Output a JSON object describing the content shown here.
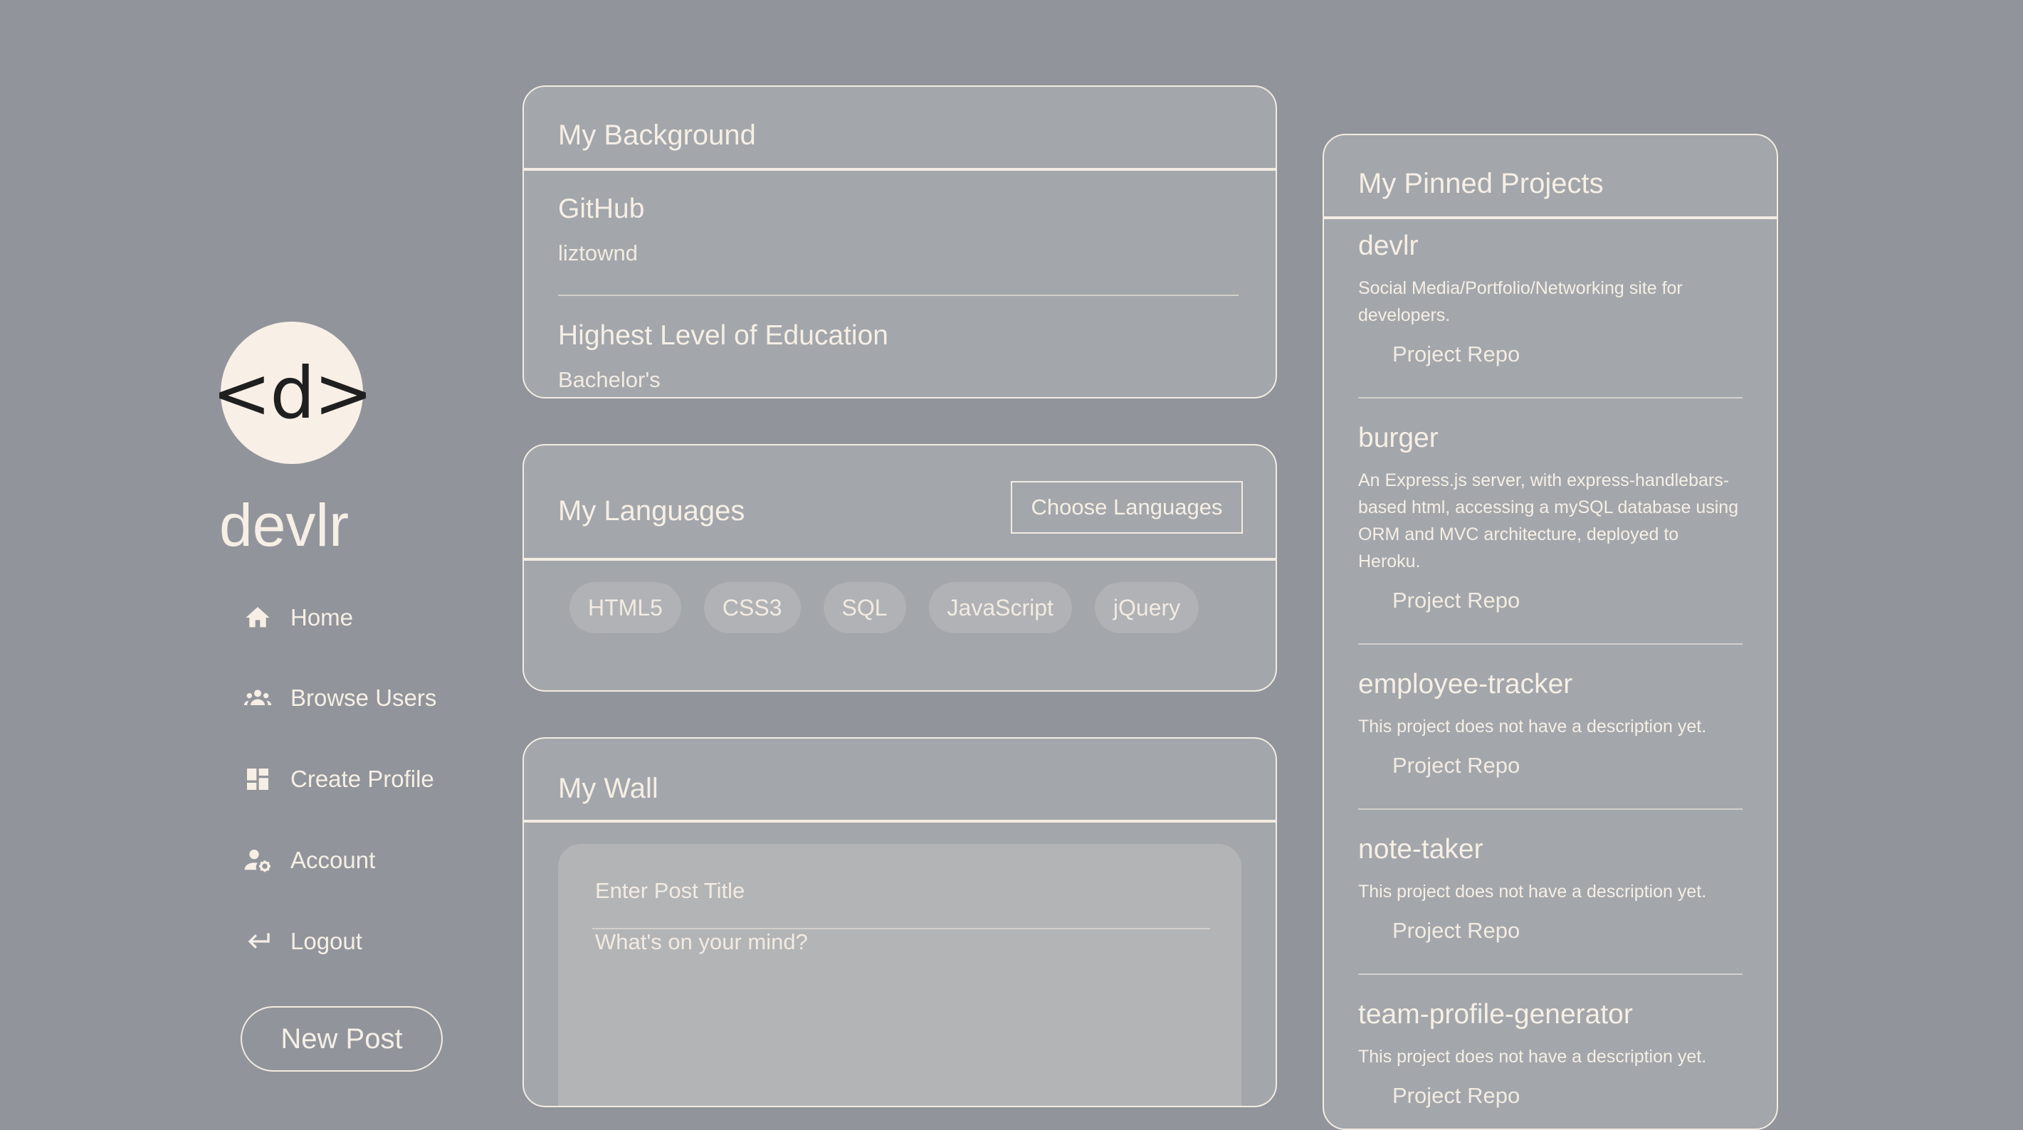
{
  "brand": {
    "logo_text": "<d>",
    "name": "devlr"
  },
  "sidebar": {
    "items": [
      {
        "label": "Home",
        "icon": "home-icon"
      },
      {
        "label": "Browse Users",
        "icon": "group-icon"
      },
      {
        "label": "Create Profile",
        "icon": "dashboard-icon"
      },
      {
        "label": "Account",
        "icon": "user-settings-icon"
      },
      {
        "label": "Logout",
        "icon": "logout-arrow-icon"
      }
    ],
    "new_post_label": "New Post"
  },
  "background": {
    "title": "My Background",
    "github_label": "GitHub",
    "github_value": "liztownd",
    "education_label": "Highest Level of Education",
    "education_value": "Bachelor's"
  },
  "languages": {
    "title": "My Languages",
    "choose_button": "Choose Languages",
    "items": [
      "HTML5",
      "CSS3",
      "SQL",
      "JavaScript",
      "jQuery"
    ]
  },
  "wall": {
    "title": "My Wall",
    "title_placeholder": "Enter Post Title",
    "body_placeholder": "What's on your mind?"
  },
  "projects": {
    "title": "My Pinned Projects",
    "items": [
      {
        "name": "devlr",
        "description": "Social Media/Portfolio/Networking site for developers.",
        "repo_label": "Project Repo"
      },
      {
        "name": "burger",
        "description": "An Express.js server, with express-handlebars-based html, accessing a mySQL database using ORM and MVC architecture, deployed to Heroku.",
        "repo_label": "Project Repo"
      },
      {
        "name": "employee-tracker",
        "description": "This project does not have a description yet.",
        "repo_label": "Project Repo"
      },
      {
        "name": "note-taker",
        "description": "This project does not have a description yet.",
        "repo_label": "Project Repo"
      },
      {
        "name": "team-profile-generator",
        "description": "This project does not have a description yet.",
        "repo_label": "Project Repo"
      }
    ]
  },
  "colors": {
    "page_background": "#91949a",
    "card_background": "#a3a6aa",
    "accent_text": "#f6efe6",
    "logo_background": "#f8efe6"
  }
}
